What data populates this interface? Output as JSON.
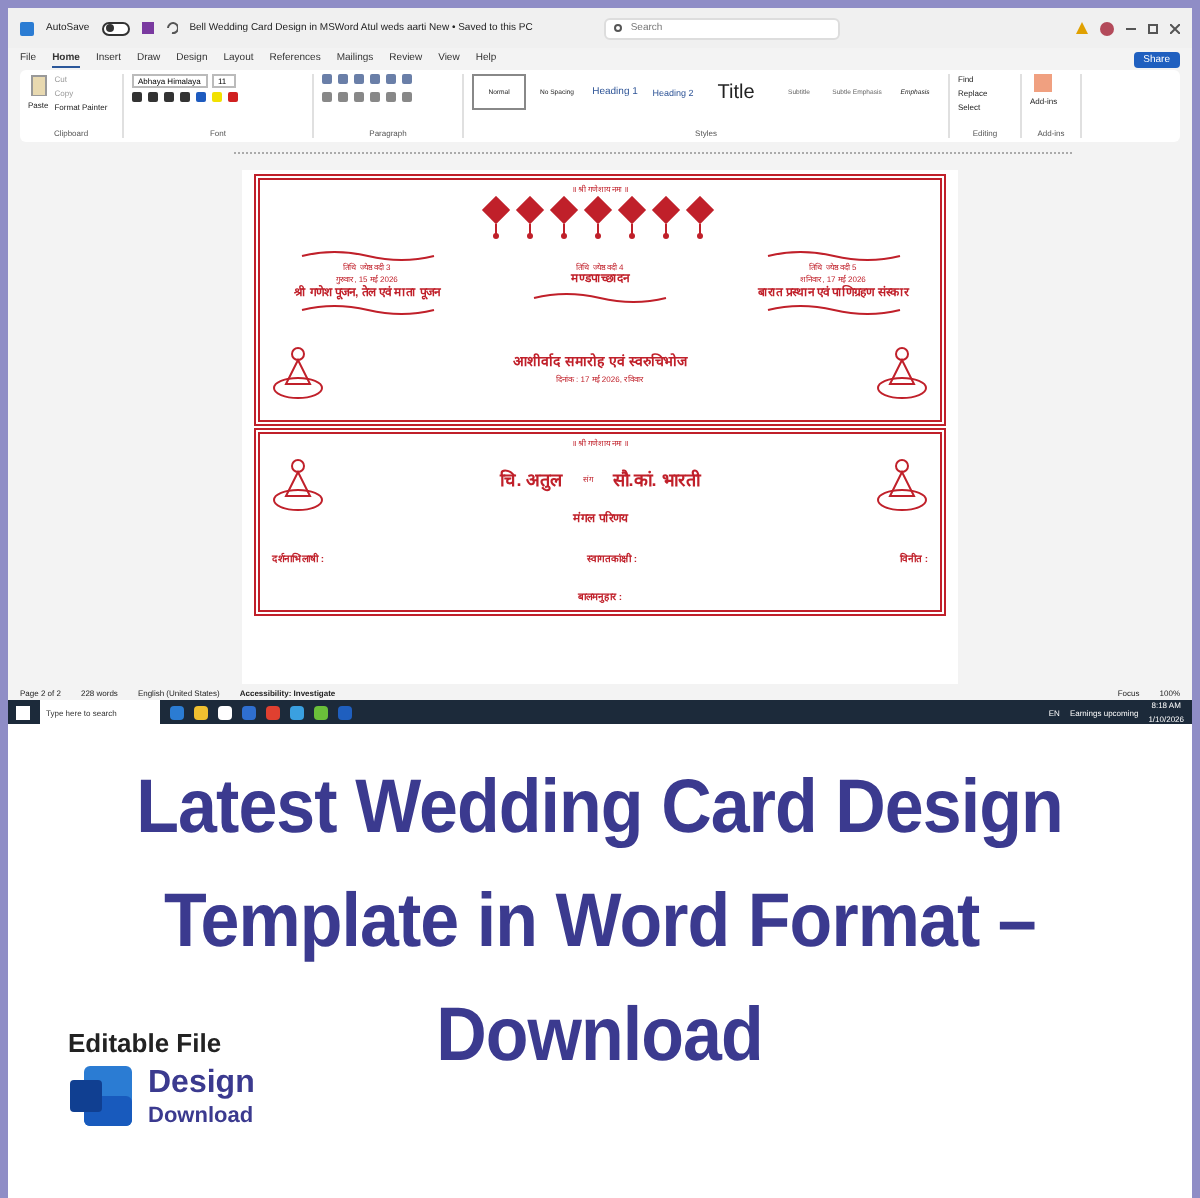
{
  "window": {
    "autosave_label": "AutoSave",
    "autosave_on": false,
    "title": "Bell Wedding Card Design in MSWord Atul weds aarti New • Saved to this PC",
    "search": {
      "placeholder": "Search"
    },
    "share": "Share"
  },
  "menu_tabs": [
    {
      "label": "File",
      "selected": false
    },
    {
      "label": "Home",
      "selected": true
    },
    {
      "label": "Insert",
      "selected": false
    },
    {
      "label": "Draw",
      "selected": false
    },
    {
      "label": "Design",
      "selected": false
    },
    {
      "label": "Layout",
      "selected": false
    },
    {
      "label": "References",
      "selected": false
    },
    {
      "label": "Mailings",
      "selected": false
    },
    {
      "label": "Review",
      "selected": false
    },
    {
      "label": "View",
      "selected": false
    },
    {
      "label": "Help",
      "selected": false
    }
  ],
  "ribbon": {
    "clipboard": {
      "paste": "Paste",
      "cut": "Cut",
      "copy": "Copy",
      "format_painter": "Format Painter",
      "label": "Clipboard"
    },
    "font": {
      "name": "Abhaya Himalaya",
      "size": "11",
      "label": "Font"
    },
    "paragraph": {
      "label": "Paragraph"
    },
    "styles": {
      "label": "Styles",
      "items": [
        {
          "label": "Normal",
          "kind": "normal",
          "selected": true
        },
        {
          "label": "No Spacing",
          "kind": "normal",
          "selected": false
        },
        {
          "label": "Heading 1",
          "kind": "heading",
          "selected": false
        },
        {
          "label": "Heading 2",
          "kind": "heading2",
          "selected": false
        },
        {
          "label": "Title",
          "kind": "title",
          "selected": false
        },
        {
          "label": "Subtitle",
          "kind": "subtle",
          "selected": false
        },
        {
          "label": "Subtle Emphasis",
          "kind": "subtle",
          "selected": false
        },
        {
          "label": "Emphasis",
          "kind": "emphasis",
          "selected": false
        }
      ]
    },
    "editing": {
      "find": "Find",
      "replace": "Replace",
      "select": "Select",
      "label": "Editing"
    },
    "addins": {
      "button": "Add-ins",
      "label": "Add-ins"
    }
  },
  "cards": [
    {
      "kind": "events",
      "top": "॥ श्री गणेशाय नमः ॥",
      "left": [
        "तिथि ज्येष्ठ वदी 3",
        "गुरुवार, 15 मई 2026",
        "श्री गणेश पूजन, तेल एवं माता पूजन"
      ],
      "center": [
        "तिथि ज्येष्ठ वदी 4",
        "मण्डपाच्छादन"
      ],
      "right": [
        "तिथि ज्येष्ठ वदी 5",
        "शनिवार, 17 मई 2026",
        "बारात प्रस्थान एवं पाणिग्रहण संस्कार"
      ],
      "bottom": [
        "आशीर्वाद समारोह एवं स्वरुचिभोज",
        "दिनांक : 17 मई 2026, रविवार"
      ]
    },
    {
      "kind": "invite",
      "top": "॥ श्री गणेशाय नमः ॥",
      "groom": "चि. अतुल",
      "joiner": "संग",
      "bride": "सौ.कां. भारती",
      "center": "मंगल परिणय",
      "left_heading": "दर्शनाभिलाषी :",
      "middle_heading": "स्वागतकांक्षी :",
      "right_heading": "विनीत :",
      "bottom": "बालमनुहार :"
    }
  ],
  "status_bar": {
    "page": "Page 2 of 2",
    "words": "228 words",
    "language": "English (United States)",
    "accessibility": "Accessibility: Investigate",
    "focus": "Focus",
    "zoom": "100%"
  },
  "taskbar": {
    "search_placeholder": "Type here to search",
    "language": "EN",
    "news": "Earnings upcoming",
    "time": "8:18 AM",
    "date": "1/10/2026"
  },
  "headline": [
    "Latest Wedding Card Design",
    "Template in Word Format –",
    "Download"
  ],
  "badge": {
    "caption": "Editable File",
    "line1": "Design",
    "line2": "Download"
  }
}
